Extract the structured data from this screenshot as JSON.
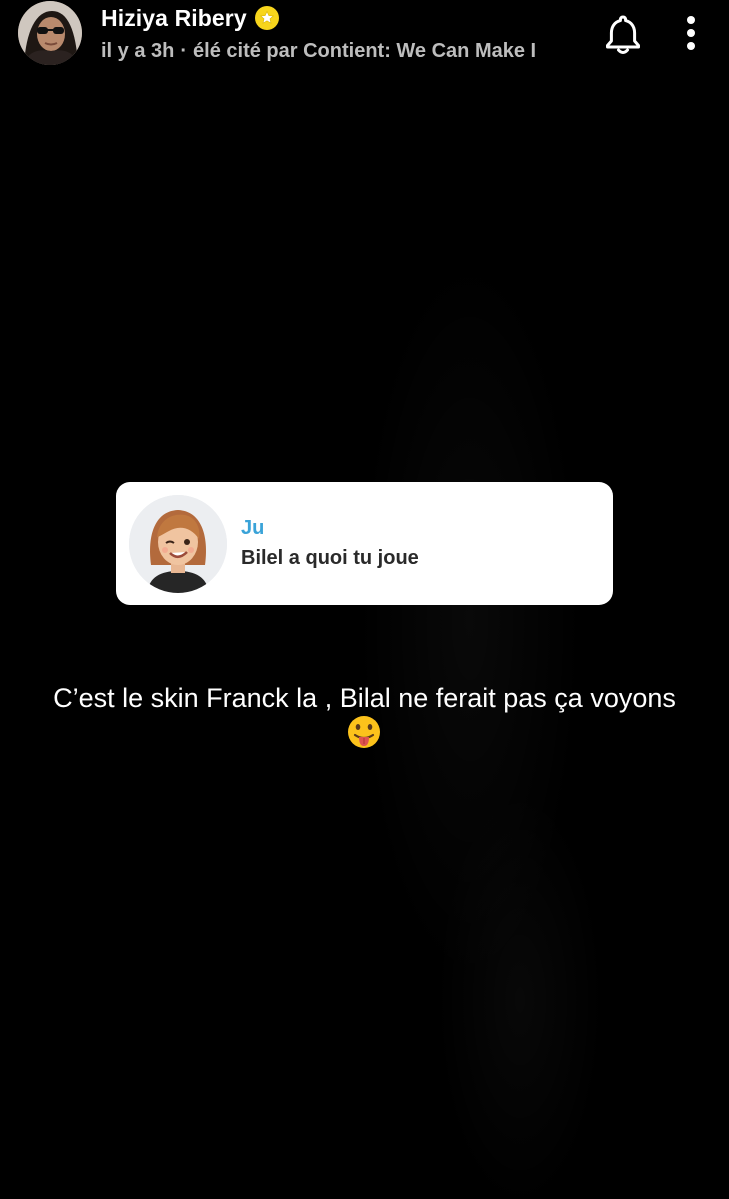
{
  "header": {
    "username": "Hiziya Ribery",
    "time_ago": "il y a 3h",
    "separator": "·",
    "subtitle": "élé cité par Contient: We Can Make I",
    "avatar_icon": "profile-photo",
    "badge_icon": "star-badge-icon",
    "badge_color": "#f7d51c",
    "bell_icon": "notification-bell-icon",
    "more_icon": "more-vertical-icon"
  },
  "reply": {
    "author": "Ju",
    "text": "Bilel a quoi tu joue",
    "author_color": "#3aa3d8",
    "avatar_icon": "bitmoji-avatar"
  },
  "caption": {
    "text": "C’est le skin Franck la , Bilal ne ferait pas ça voyons",
    "emoji": "face-with-tongue-emoji"
  }
}
